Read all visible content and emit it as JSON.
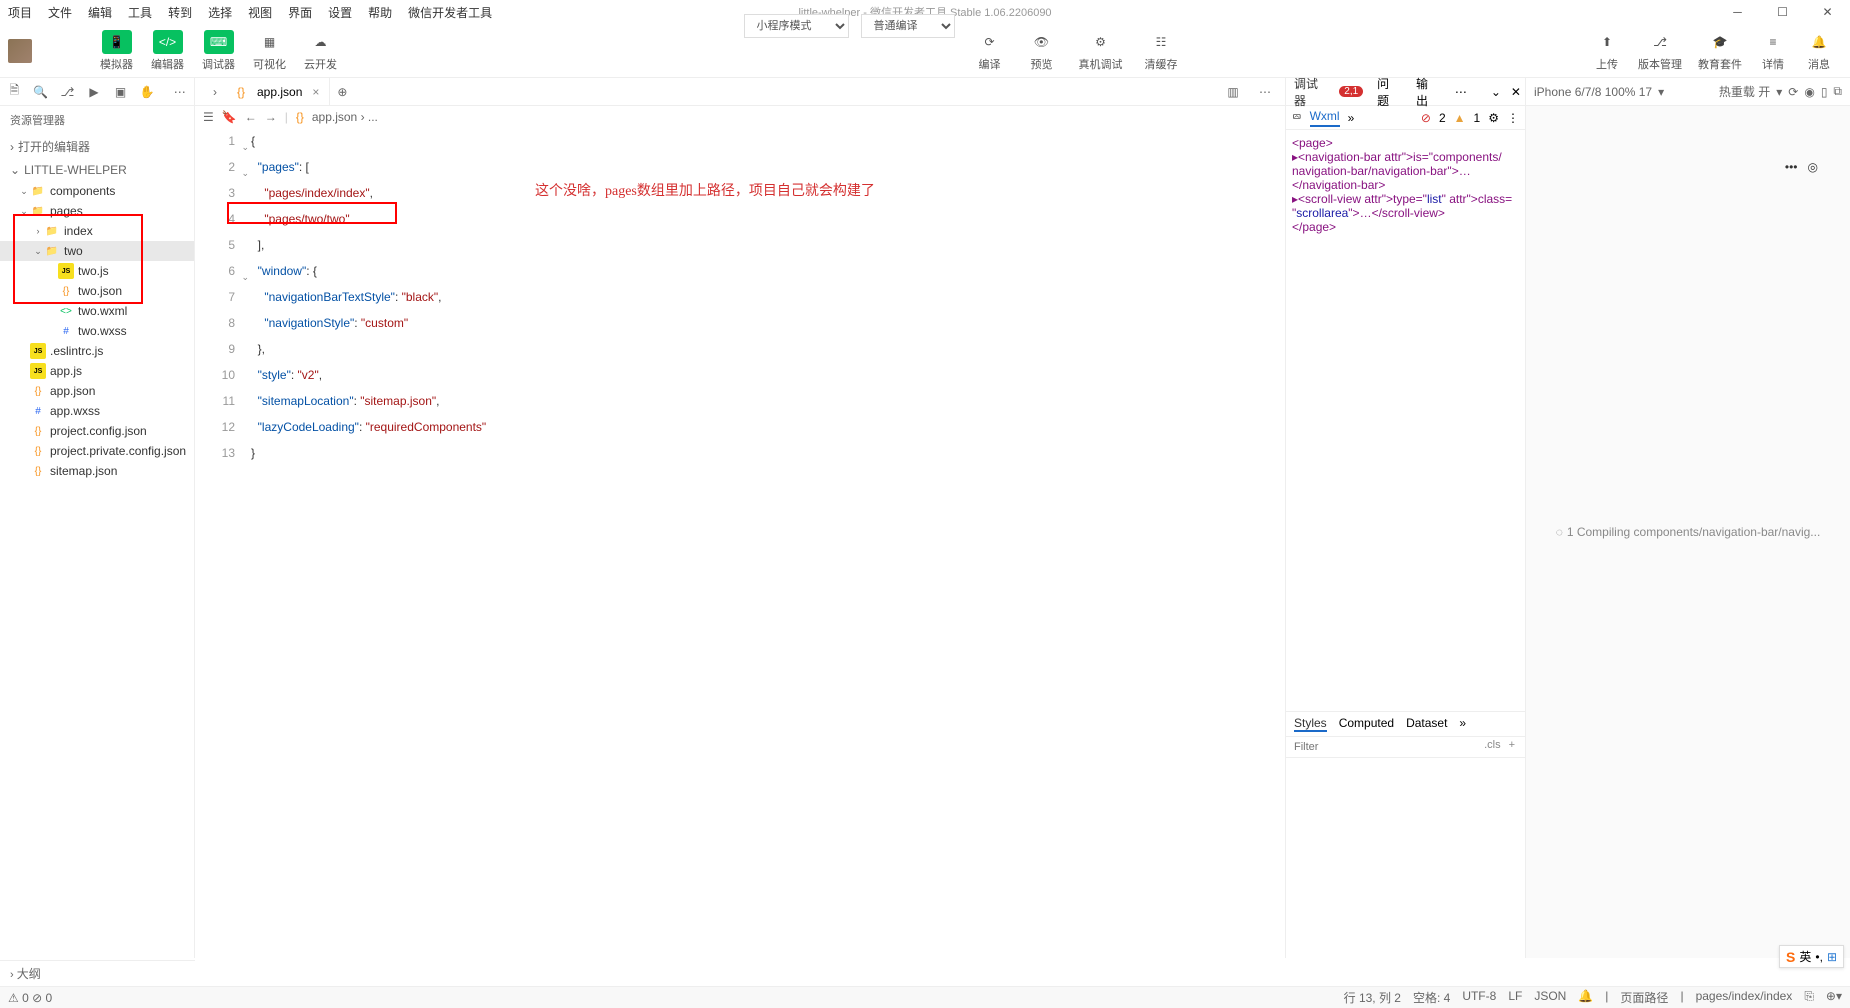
{
  "menu": [
    "项目",
    "文件",
    "编辑",
    "工具",
    "转到",
    "选择",
    "视图",
    "界面",
    "设置",
    "帮助",
    "微信开发者工具"
  ],
  "title": "little-whelper - 微信开发者工具 Stable 1.06.2206090",
  "toolbar": {
    "simulator": "模拟器",
    "editor": "编辑器",
    "debugger": "调试器",
    "visual": "可视化",
    "cloud": "云开发",
    "mode": "小程序模式",
    "compile_sel": "普通编译",
    "compile": "编译",
    "preview": "预览",
    "realdbg": "真机调试",
    "clearcache": "清缓存",
    "upload": "上传",
    "version": "版本管理",
    "edu": "教育套件",
    "detail": "详情",
    "message": "消息"
  },
  "sidebar": {
    "title": "资源管理器",
    "open_editors": "打开的编辑器",
    "project": "LITTLE-WHELPER",
    "tree": [
      {
        "l": 1,
        "t": "folder",
        "n": "components",
        "exp": true
      },
      {
        "l": 1,
        "t": "folder",
        "n": "pages",
        "exp": true
      },
      {
        "l": 2,
        "t": "folder",
        "n": "index",
        "exp": false
      },
      {
        "l": 2,
        "t": "folder",
        "n": "two",
        "exp": true,
        "sel": true,
        "red": true
      },
      {
        "l": 3,
        "t": "js",
        "n": "two.js",
        "red": true
      },
      {
        "l": 3,
        "t": "json",
        "n": "two.json",
        "red": true
      },
      {
        "l": 3,
        "t": "wxml",
        "n": "two.wxml",
        "red": true
      },
      {
        "l": 3,
        "t": "wxss",
        "n": "two.wxss",
        "red": true
      },
      {
        "l": 1,
        "t": "js",
        "n": ".eslintrc.js"
      },
      {
        "l": 1,
        "t": "js",
        "n": "app.js"
      },
      {
        "l": 1,
        "t": "json",
        "n": "app.json"
      },
      {
        "l": 1,
        "t": "wxss",
        "n": "app.wxss"
      },
      {
        "l": 1,
        "t": "json",
        "n": "project.config.json"
      },
      {
        "l": 1,
        "t": "json",
        "n": "project.private.config.json"
      },
      {
        "l": 1,
        "t": "json",
        "n": "sitemap.json"
      }
    ],
    "outline": "大纲"
  },
  "editor": {
    "tab_name": "app.json",
    "breadcrumb": "app.json › ...",
    "annotation": "这个没啥，pages数组里加上路径，项目自己就会构建了",
    "code": [
      {
        "n": 1,
        "fold": true,
        "t": [
          [
            "punc",
            "{"
          ]
        ]
      },
      {
        "n": 2,
        "fold": true,
        "t": [
          [
            "punc",
            "  "
          ],
          [
            "key",
            "\"pages\""
          ],
          [
            "punc",
            ": ["
          ]
        ]
      },
      {
        "n": 3,
        "t": [
          [
            "punc",
            "    "
          ],
          [
            "str",
            "\"pages/index/index\""
          ],
          [
            "punc",
            ","
          ]
        ]
      },
      {
        "n": 4,
        "t": [
          [
            "punc",
            "    "
          ],
          [
            "str",
            "\"pages/two/two\""
          ]
        ]
      },
      {
        "n": 5,
        "t": [
          [
            "punc",
            "  ],"
          ]
        ]
      },
      {
        "n": 6,
        "fold": true,
        "t": [
          [
            "punc",
            "  "
          ],
          [
            "key",
            "\"window\""
          ],
          [
            "punc",
            ": {"
          ]
        ]
      },
      {
        "n": 7,
        "t": [
          [
            "punc",
            "    "
          ],
          [
            "key",
            "\"navigationBarTextStyle\""
          ],
          [
            "punc",
            ": "
          ],
          [
            "str",
            "\"black\""
          ],
          [
            "punc",
            ","
          ]
        ]
      },
      {
        "n": 8,
        "t": [
          [
            "punc",
            "    "
          ],
          [
            "key",
            "\"navigationStyle\""
          ],
          [
            "punc",
            ": "
          ],
          [
            "str",
            "\"custom\""
          ]
        ]
      },
      {
        "n": 9,
        "t": [
          [
            "punc",
            "  },"
          ]
        ]
      },
      {
        "n": 10,
        "t": [
          [
            "punc",
            "  "
          ],
          [
            "key",
            "\"style\""
          ],
          [
            "punc",
            ": "
          ],
          [
            "str",
            "\"v2\""
          ],
          [
            "punc",
            ","
          ]
        ]
      },
      {
        "n": 11,
        "t": [
          [
            "punc",
            "  "
          ],
          [
            "key",
            "\"sitemapLocation\""
          ],
          [
            "punc",
            ": "
          ],
          [
            "str",
            "\"sitemap.json\""
          ],
          [
            "punc",
            ","
          ]
        ]
      },
      {
        "n": 12,
        "t": [
          [
            "punc",
            "  "
          ],
          [
            "key",
            "\"lazyCodeLoading\""
          ],
          [
            "punc",
            ": "
          ],
          [
            "str",
            "\"requiredComponents\""
          ]
        ]
      },
      {
        "n": 13,
        "t": [
          [
            "punc",
            "}"
          ]
        ]
      }
    ]
  },
  "debugger": {
    "tabs": {
      "main": "调试器",
      "badge": "2,1",
      "issues": "问题",
      "output": "输出"
    },
    "wxml": "Wxml",
    "errors": "2",
    "warnings": "1",
    "dom_lines": [
      "<page>",
      " ▸<navigation-bar is=\"components/",
      "navigation-bar/navigation-bar\">…",
      "</navigation-bar>",
      " ▸<scroll-view type=\"list\" class=",
      "\"scrollarea\">…</scroll-view>",
      "</page>"
    ],
    "styles_tabs": [
      "Styles",
      "Computed",
      "Dataset"
    ],
    "filter_ph": "Filter",
    "cls": ".cls"
  },
  "preview": {
    "device": "iPhone 6/7/8 100% 17",
    "hot": "热重载 开",
    "compiling": "1 Compiling components/navigation-bar/navig..."
  },
  "ime": {
    "label": "英"
  },
  "status": {
    "err": "0",
    "warn": "0",
    "pos": "行 13, 列 2",
    "spaces": "空格: 4",
    "enc": "UTF-8",
    "eol": "LF",
    "lang": "JSON",
    "pagepath": "页面路径",
    "path": "pages/index/index"
  }
}
